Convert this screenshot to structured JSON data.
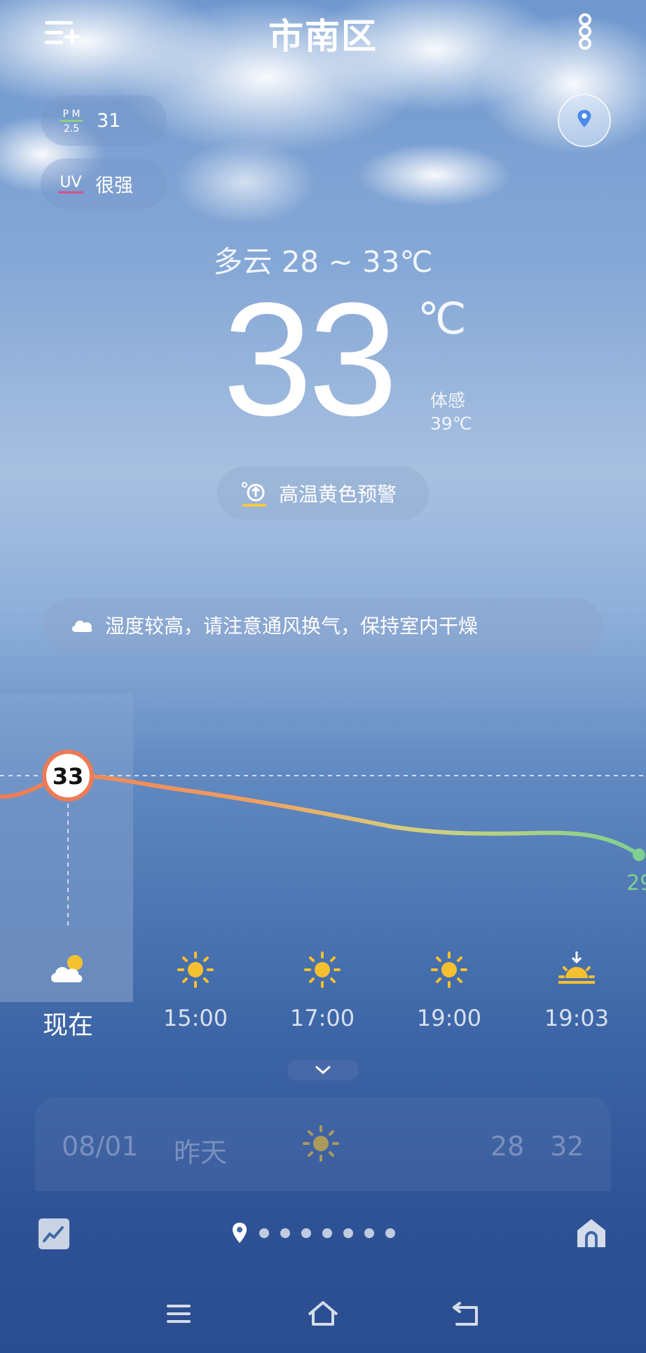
{
  "header": {
    "city": "市南区"
  },
  "air": {
    "pm_label_top": "P M",
    "pm_label_bottom": "2.5",
    "pm_value": "31",
    "uv_label": "UV",
    "uv_value": "很强"
  },
  "current": {
    "condition_range": "多云  28 ~ 33℃",
    "temp": "33",
    "unit": "℃",
    "feel_label": "体感",
    "feel_value": "39℃"
  },
  "alert": {
    "text": "高温黄色预警",
    "color": "#f5c842"
  },
  "tip": {
    "text": "湿度较高，请注意通风换气，保持室内干燥"
  },
  "hourly": {
    "current_label": "33",
    "end_label": "29",
    "items": [
      {
        "time": "现在",
        "icon": "partly-cloudy-icon"
      },
      {
        "time": "15:00",
        "icon": "sun-icon"
      },
      {
        "time": "17:00",
        "icon": "sun-icon"
      },
      {
        "time": "19:00",
        "icon": "sun-icon"
      },
      {
        "time": "19:03",
        "icon": "sunset-icon"
      }
    ]
  },
  "daily": {
    "date": "08/01",
    "day": "昨天",
    "icon": "sun-icon",
    "low": "28",
    "high": "32"
  },
  "colors": {
    "sun": "#f5c030",
    "curve_warm": "#ee7a55",
    "curve_cool": "#7fd090"
  }
}
